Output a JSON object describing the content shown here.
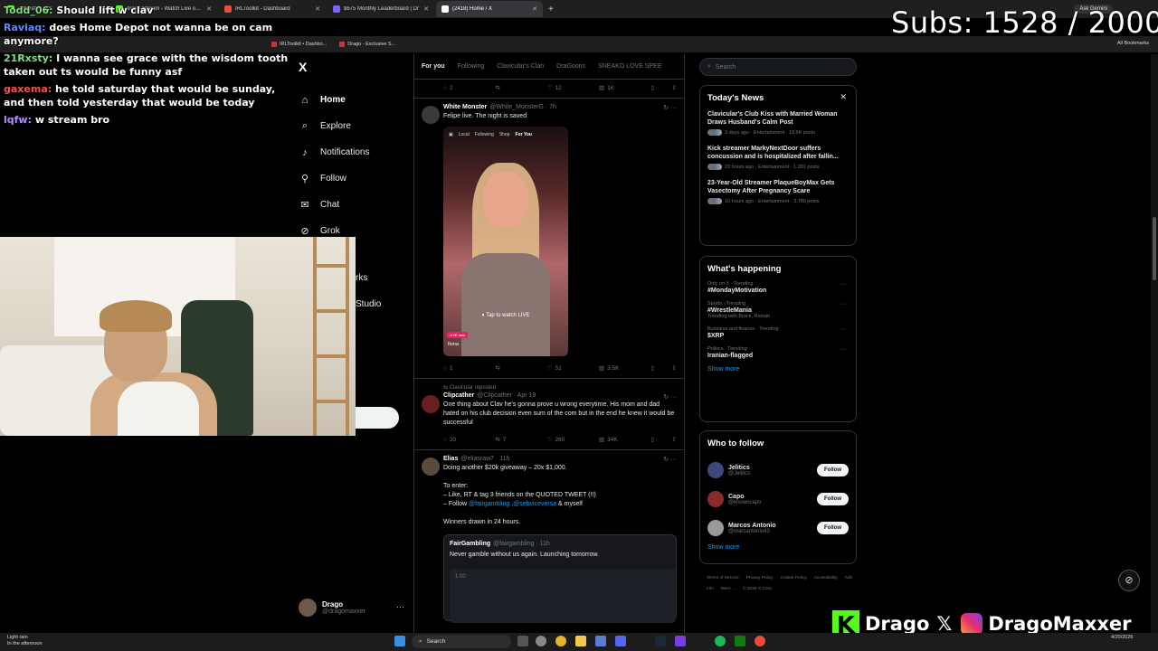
{
  "browser": {
    "tabs": [
      {
        "title": "antijest5675d:",
        "color": "#53fc18",
        "active": false
      },
      {
        "title": "drago Stream - Watch Live on K",
        "color": "#53fc18",
        "active": false
      },
      {
        "title": "IRLToolkit - Dashboard",
        "color": "#e74c3c",
        "active": false
      },
      {
        "title": "$675 Monthly Leaderboard | Dr",
        "color": "#7b61ff",
        "active": false
      },
      {
        "title": "(2418) Home / X",
        "color": "#ffffff",
        "active": true
      }
    ],
    "bookmarks": [
      {
        "label": "IRLToolkit • Dashbo..."
      },
      {
        "label": "Drago - Exclusive S..."
      }
    ],
    "all_bookmarks": "All Bookmarks",
    "ask_gemini": "Ask Gemini"
  },
  "overlay": {
    "subs_text": "Subs: 1528 / 2000",
    "chat": [
      {
        "user": "Todd_06:",
        "user_color": "#7fe07f",
        "text": "Should lift w clav"
      },
      {
        "user": "Raviaq:",
        "user_color": "#5b8cff",
        "text": "does Home Depot not wanna be on cam anymore?"
      },
      {
        "user": "21Rxsty:",
        "user_color": "#7fe07f",
        "text": "I wanna see grace with the wisdom tooth taken out ts would be funny asf"
      },
      {
        "user": "gaxema:",
        "user_color": "#ff4d4d",
        "text": "he told saturday that would be sunday, and then told yesterday that would be today"
      },
      {
        "user": "lqfw:",
        "user_color": "#b88cff",
        "text": "w stream bro"
      }
    ],
    "brand": {
      "name": "Drago",
      "ig": "DragoMaxxer"
    }
  },
  "x_nav": {
    "logo": "X",
    "items": [
      {
        "label": "Home",
        "icon": "home-icon",
        "glyph": "⌂",
        "active": true
      },
      {
        "label": "Explore",
        "icon": "search-icon",
        "glyph": "⌕",
        "active": false
      },
      {
        "label": "Notifications",
        "icon": "bell-icon",
        "glyph": "♪",
        "active": false
      },
      {
        "label": "Follow",
        "icon": "person-add-icon",
        "glyph": "⚲",
        "active": false
      },
      {
        "label": "Chat",
        "icon": "chat-icon",
        "glyph": "✉",
        "active": false
      },
      {
        "label": "Grok",
        "icon": "grok-icon",
        "glyph": "⊘",
        "active": false
      }
    ],
    "extra1": "rks",
    "extra2": "Studio",
    "profile": {
      "name": "Drago",
      "handle": "@dragomaxxer"
    }
  },
  "feed": {
    "tabs": [
      "For you",
      "Following",
      "Clavicular's Clan",
      "DraGoons",
      "SNEAKO LOVE SPEE"
    ],
    "top_actions": {
      "replies": "2",
      "reposts": "",
      "likes": "12",
      "views": "1K"
    },
    "posts": [
      {
        "name": "White Monster",
        "handle": "@White_MonsterG · 7h",
        "text": "Felipe live. The night is saved",
        "video": {
          "tabs": [
            "Local",
            "Following",
            "Shop",
            "For You"
          ],
          "tap": "Tap to watch LIVE",
          "live_badge": "LIVE now",
          "streamer": "fiona"
        },
        "actions": {
          "replies": "1",
          "reposts": "",
          "likes": "51",
          "views": "3.5K"
        }
      },
      {
        "reposted_by": "Clavicular reposted",
        "name": "Clipcather",
        "handle": "@Clipcather · Apr 19",
        "text": "One thing about Clav he's gonna prove u wrong everytime. His mom and dad hated on his club decision even sum of the com but in the end he knew it would be successful",
        "actions": {
          "replies": "20",
          "reposts": "7",
          "likes": "260",
          "views": "34K"
        }
      },
      {
        "name": "Elias",
        "handle": "@eliasraw7 · 11h",
        "lines": [
          "Doing another $20k giveaway – 20x $1,000.",
          "",
          "To enter:",
          "– Like, RT & tag 3 friends on the QUOTED TWEET (!!)"
        ],
        "follow_prefix": "– Follow ",
        "follow_links": "@fairgambling ,@sebviceversa",
        "follow_suffix": " & myself",
        "winners": "Winners drawn in 24 hours.",
        "quote": {
          "name": "FairGambling",
          "handle": "@fairgambling · 11h",
          "text": "Never gamble without us again. Launching tomorrow.",
          "value": "1.00"
        }
      }
    ]
  },
  "right": {
    "search_placeholder": "Search",
    "news": {
      "title": "Today's News",
      "items": [
        {
          "title": "Clavicular's Club Kiss with Married Woman Draws Husband's Calm Post",
          "meta": "3 days ago · Entertainment · 19.5K posts"
        },
        {
          "title": "Kick streamer MarkyNextDoor suffers concussion and is hospitalized after fallin...",
          "meta": "23 hours ago · Entertainment · 1,281 posts"
        },
        {
          "title": "23-Year-Old Streamer PlaqueBoyMax Gets Vasectomy After Pregnancy Scare",
          "meta": "10 hours ago · Entertainment · 3,780 posts"
        }
      ]
    },
    "happening": {
      "title": "What's happening",
      "trends": [
        {
          "context": "Only on X · Trending",
          "name": "#MondayMotivation",
          "with": ""
        },
        {
          "context": "Sports · Trending",
          "name": "#WrestleMania",
          "with": "Trending with Brock, Roman"
        },
        {
          "context": "Business and finance · Trending",
          "name": "$XRP",
          "with": ""
        },
        {
          "context": "Politics · Trending",
          "name": "Iranian-flagged",
          "with": ""
        }
      ],
      "show_more": "Show more"
    },
    "who_to_follow": {
      "title": "Who to follow",
      "people": [
        {
          "name": "Jelitics",
          "handle": "@Jelitics",
          "button": "Follow"
        },
        {
          "name": "Capo",
          "handle": "@knowncapo",
          "button": "Follow"
        },
        {
          "name": "Marcos Antonio",
          "handle": "@marcantonio43",
          "button": "Follow"
        }
      ],
      "show_more": "Show more"
    },
    "footer": [
      "Terms of Service",
      "Privacy Policy",
      "Cookie Policy",
      "Accessibility",
      "Ads info",
      "More ...",
      "© 2026 X Corp."
    ]
  },
  "taskbar": {
    "weather_line1": "Light rain",
    "weather_line2": "In the afternoon",
    "search": "Search",
    "time": "",
    "date": "4/20/2026"
  }
}
